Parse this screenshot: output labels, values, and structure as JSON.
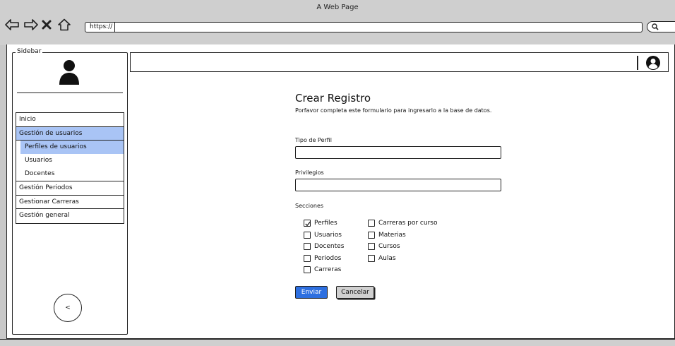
{
  "window": {
    "title": "A Web Page",
    "url": "https://"
  },
  "sidebar": {
    "legend": "Sidebar",
    "menu": [
      {
        "label": "Inicio"
      },
      {
        "label": "Gestión de usuarios"
      },
      {
        "label": "Perfiles de usuarios"
      },
      {
        "label": "Usuarios"
      },
      {
        "label": "Docentes"
      },
      {
        "label": "Gestión Periodos"
      },
      {
        "label": "Gestionar Carreras"
      },
      {
        "label": "Gestión general"
      }
    ],
    "collapse_label": "<"
  },
  "form": {
    "title": "Crear Registro",
    "subtitle": "Porfavor completa este formulario para ingresarlo a la base de datos.",
    "field1_label": "Tipo de Perfil",
    "field1_value": "",
    "field2_label": "Privilegios",
    "field2_value": "",
    "sections_label": "Secciones",
    "col1": [
      {
        "label": "Perfiles",
        "checked": true
      },
      {
        "label": "Usuarios",
        "checked": false
      },
      {
        "label": "Docentes",
        "checked": false
      },
      {
        "label": "Periodos",
        "checked": false
      },
      {
        "label": "Carreras",
        "checked": false
      }
    ],
    "col2": [
      {
        "label": "Carreras por curso",
        "checked": false
      },
      {
        "label": "Materias",
        "checked": false
      },
      {
        "label": "Cursos",
        "checked": false
      },
      {
        "label": "Aulas",
        "checked": false
      }
    ],
    "submit_label": "Enviar",
    "cancel_label": "Cancelar"
  },
  "colors": {
    "accent": "#2d6fe0",
    "highlight": "#a9c4f5"
  }
}
